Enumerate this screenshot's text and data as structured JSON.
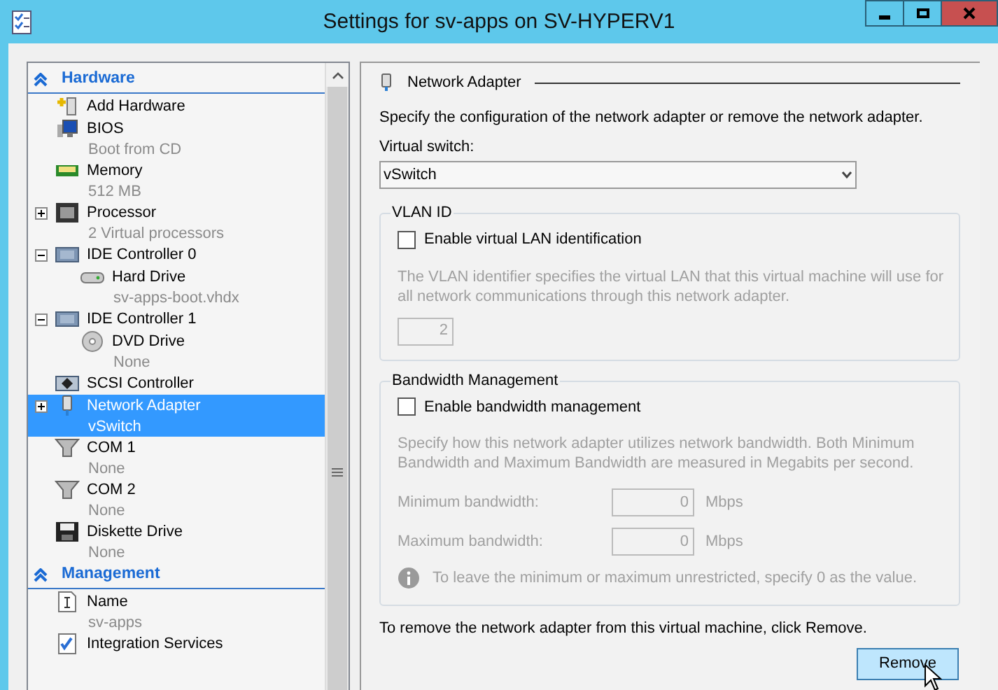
{
  "window": {
    "title": "Settings for sv-apps on SV-HYPERV1"
  },
  "sidebar": {
    "sections": [
      {
        "title": "Hardware",
        "expanded": true,
        "items": [
          {
            "kind": "add",
            "label": "Add Hardware",
            "selected": false
          },
          {
            "kind": "bios",
            "label": "BIOS",
            "detail": "Boot from CD",
            "selected": false
          },
          {
            "kind": "memory",
            "label": "Memory",
            "detail": "512 MB",
            "selected": false
          },
          {
            "kind": "processor",
            "label": "Processor",
            "detail": "2 Virtual processors",
            "expanded": false,
            "selected": false
          },
          {
            "kind": "ide",
            "label": "IDE Controller 0",
            "expanded": true,
            "selected": false,
            "children": [
              {
                "kind": "disk",
                "label": "Hard Drive",
                "detail": "sv-apps-boot.vhdx",
                "selected": false
              }
            ]
          },
          {
            "kind": "ide",
            "label": "IDE Controller 1",
            "expanded": true,
            "selected": false,
            "children": [
              {
                "kind": "dvd",
                "label": "DVD Drive",
                "detail": "None",
                "selected": false
              }
            ]
          },
          {
            "kind": "scsi",
            "label": "SCSI Controller",
            "selected": false
          },
          {
            "kind": "network",
            "label": "Network Adapter",
            "detail": "vSwitch",
            "expanded": false,
            "selected": true
          },
          {
            "kind": "com",
            "label": "COM 1",
            "detail": "None",
            "selected": false
          },
          {
            "kind": "com",
            "label": "COM 2",
            "detail": "None",
            "selected": false
          },
          {
            "kind": "floppy",
            "label": "Diskette Drive",
            "detail": "None",
            "selected": false
          }
        ]
      },
      {
        "title": "Management",
        "expanded": true,
        "items": [
          {
            "kind": "name",
            "label": "Name",
            "detail": "sv-apps",
            "selected": false
          },
          {
            "kind": "integration",
            "label": "Integration Services",
            "selected": false
          }
        ]
      }
    ]
  },
  "panel": {
    "title": "Network Adapter",
    "description": "Specify the configuration of the network adapter or remove the network adapter.",
    "switch": {
      "label": "Virtual switch:",
      "value": "vSwitch"
    },
    "vlan": {
      "title": "VLAN ID",
      "checkbox": {
        "label": "Enable virtual LAN identification",
        "checked": false
      },
      "help": "The VLAN identifier specifies the virtual LAN that this virtual machine will use for all network communications through this network adapter.",
      "value": "2",
      "disabled": true
    },
    "bandwidth": {
      "title": "Bandwidth Management",
      "checkbox": {
        "label": "Enable bandwidth management",
        "checked": false
      },
      "help": "Specify how this network adapter utilizes network bandwidth. Both Minimum Bandwidth and Maximum Bandwidth are measured in Megabits per second.",
      "disabled": true,
      "fields": [
        {
          "label": "Minimum bandwidth:",
          "value": "0",
          "unit": "Mbps"
        },
        {
          "label": "Maximum bandwidth:",
          "value": "0",
          "unit": "Mbps"
        }
      ],
      "note": "To leave the minimum or maximum unrestricted, specify 0 as the value."
    },
    "remove_text": "To remove the network adapter from this virtual machine, click Remove.",
    "remove_button": "Remove"
  }
}
